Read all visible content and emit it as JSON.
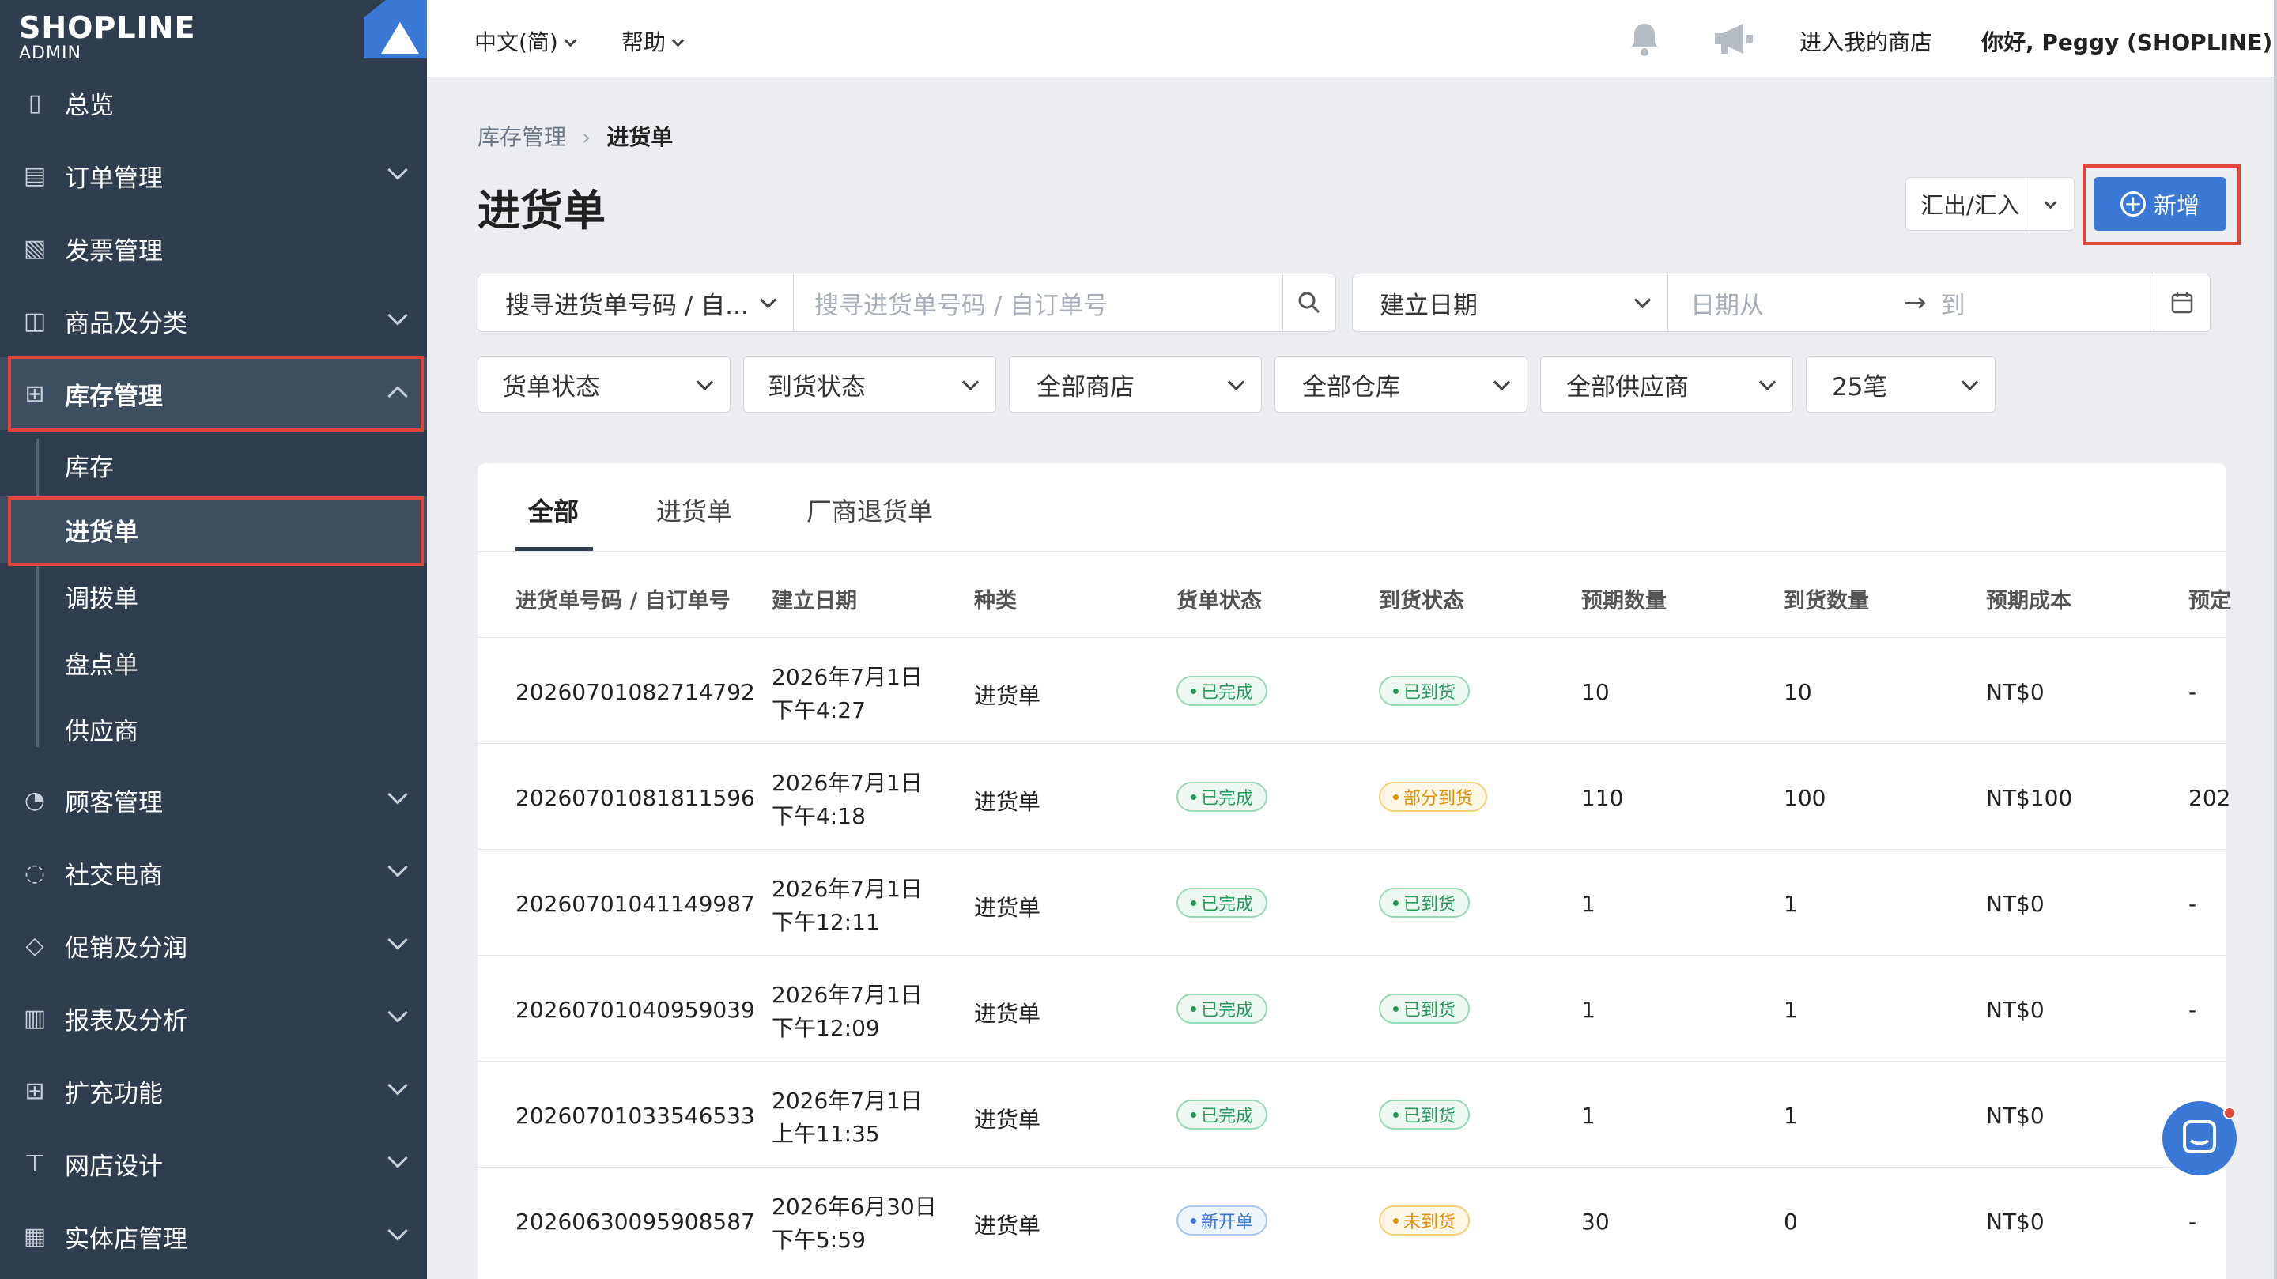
{
  "logo": {
    "name": "SHOPLINE",
    "sub": "ADMIN"
  },
  "sidebar": {
    "items": [
      {
        "id": "overview",
        "label": "总览",
        "icon": "dashboard-icon"
      },
      {
        "id": "orders",
        "label": "订单管理",
        "icon": "order-icon"
      },
      {
        "id": "invoices",
        "label": "发票管理",
        "icon": "invoice-icon"
      },
      {
        "id": "products",
        "label": "商品及分类",
        "icon": "bag-icon"
      },
      {
        "id": "inventory",
        "label": "库存管理",
        "icon": "inventory-icon"
      },
      {
        "id": "customers",
        "label": "顾客管理",
        "icon": "user-icon"
      },
      {
        "id": "social",
        "label": "社交电商",
        "icon": "chat-bubble-icon"
      },
      {
        "id": "promotions",
        "label": "促销及分润",
        "icon": "tag-icon"
      },
      {
        "id": "reports",
        "label": "报表及分析",
        "icon": "chart-icon"
      },
      {
        "id": "apps",
        "label": "扩充功能",
        "icon": "grid-icon"
      },
      {
        "id": "design",
        "label": "网店设计",
        "icon": "paint-roller-icon"
      },
      {
        "id": "pos",
        "label": "实体店管理",
        "icon": "store-icon"
      }
    ],
    "inventory_sub": [
      "库存",
      "进货单",
      "调拨单",
      "盘点单",
      "供应商"
    ]
  },
  "topbar": {
    "language": "中文(简)",
    "help": "帮助",
    "enter_store": "进入我的商店",
    "greeting": "你好, Peggy (SHOPLINE)"
  },
  "breadcrumb": {
    "parent": "库存管理",
    "current": "进货单"
  },
  "page": {
    "title": "进货单",
    "export_label": "汇出/汇入",
    "new_label": "新增"
  },
  "filters": {
    "search_type": "搜寻进货单号码 / 自...",
    "search_placeholder": "搜寻进货单号码 / 自订单号",
    "date_type": "建立日期",
    "date_from": "日期从",
    "date_to": "到",
    "order_status": "货单状态",
    "arrival_status": "到货状态",
    "store": "全部商店",
    "warehouse": "全部仓库",
    "supplier": "全部供应商",
    "per_page": "25笔"
  },
  "tabs": [
    "全部",
    "进货单",
    "厂商退货单"
  ],
  "table": {
    "columns": [
      "进货单号码 / 自订单号",
      "建立日期",
      "种类",
      "货单状态",
      "到货状态",
      "预期数量",
      "到货数量",
      "预期成本",
      "预定"
    ],
    "rows": [
      {
        "id": "20260701082714792",
        "date": "2026年7月1日",
        "time": "下午4:27",
        "type": "进货单",
        "status": "已完成",
        "arrival": "已到货",
        "expected_qty": "10",
        "arrived_qty": "10",
        "cost": "NT$0",
        "scheduled": "-"
      },
      {
        "id": "20260701081811596",
        "date": "2026年7月1日",
        "time": "下午4:18",
        "type": "进货单",
        "status": "已完成",
        "arrival": "部分到货",
        "expected_qty": "110",
        "arrived_qty": "100",
        "cost": "NT$100",
        "scheduled": "202"
      },
      {
        "id": "20260701041149987",
        "date": "2026年7月1日",
        "time": "下午12:11",
        "type": "进货单",
        "status": "已完成",
        "arrival": "已到货",
        "expected_qty": "1",
        "arrived_qty": "1",
        "cost": "NT$0",
        "scheduled": "-"
      },
      {
        "id": "20260701040959039",
        "date": "2026年7月1日",
        "time": "下午12:09",
        "type": "进货单",
        "status": "已完成",
        "arrival": "已到货",
        "expected_qty": "1",
        "arrived_qty": "1",
        "cost": "NT$0",
        "scheduled": "-"
      },
      {
        "id": "20260701033546533",
        "date": "2026年7月1日",
        "time": "上午11:35",
        "type": "进货单",
        "status": "已完成",
        "arrival": "已到货",
        "expected_qty": "1",
        "arrived_qty": "1",
        "cost": "NT$0",
        "scheduled": "-"
      },
      {
        "id": "20260630095908587",
        "date": "2026年6月30日",
        "time": "下午5:59",
        "type": "进货单",
        "status": "新开单",
        "arrival": "未到货",
        "expected_qty": "30",
        "arrived_qty": "0",
        "cost": "NT$0",
        "scheduled": "-"
      }
    ],
    "status_colors": {
      "已完成": "green",
      "已到货": "green",
      "部分到货": "orange",
      "新开单": "blue",
      "未到货": "orange"
    }
  },
  "colors": {
    "sidebar": "#2f3d4f",
    "accent": "#3a78d6",
    "highlight": "#e0463a"
  }
}
